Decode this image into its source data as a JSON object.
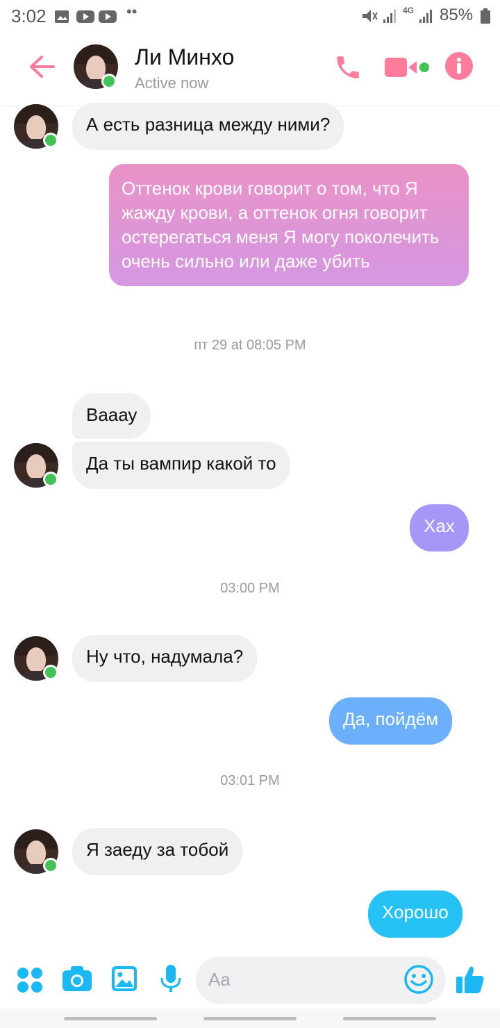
{
  "status_bar": {
    "time": "3:02",
    "battery": "85%",
    "network": "4G",
    "icons": [
      "gallery-icon",
      "youtube-icon",
      "youtube-icon",
      "more-icon",
      "mute-icon",
      "signal-icon",
      "signal-icon",
      "battery-icon"
    ]
  },
  "header": {
    "contact_name": "Ли Минхо",
    "status": "Active now",
    "colors": {
      "accent": "#ff7c9c",
      "online": "#44c25a"
    },
    "icons": [
      "back-arrow-icon",
      "phone-icon",
      "video-icon",
      "info-icon"
    ]
  },
  "messages": [
    {
      "type": "in",
      "text": "А есть разница между ними?"
    },
    {
      "type": "out",
      "text": "Оттенок крови говорит о том, что Я жажду крови, а оттенок огня говорит остерегаться меня Я могу поколечить очень сильно или даже убить"
    },
    {
      "type": "timestamp",
      "text": "пт 29 at 08:05 PM"
    },
    {
      "type": "in",
      "text": "Вааау"
    },
    {
      "type": "in",
      "text": "Да ты вампир какой то"
    },
    {
      "type": "out",
      "text": "Хах"
    },
    {
      "type": "timestamp",
      "text": "03:00 PM"
    },
    {
      "type": "in",
      "text": "Ну что, надумала?"
    },
    {
      "type": "out",
      "text": "Да, пойдём"
    },
    {
      "type": "timestamp",
      "text": "03:01 PM"
    },
    {
      "type": "in",
      "text": "Я заеду за тобой"
    },
    {
      "type": "out",
      "text": "Хорошо"
    }
  ],
  "bubble_colors": {
    "incoming": "#f0f0f3",
    "out_pink": "#e08ed0",
    "out_violet": "#a596f8",
    "out_blue": "#6cb0fb",
    "out_cyan": "#26c2f5"
  },
  "composer": {
    "placeholder": "Aa",
    "icon_color": "#1bb8f3",
    "icons": [
      "apps-icon",
      "camera-icon",
      "gallery-icon",
      "microphone-icon",
      "emoji-icon",
      "thumbs-up-icon"
    ]
  }
}
